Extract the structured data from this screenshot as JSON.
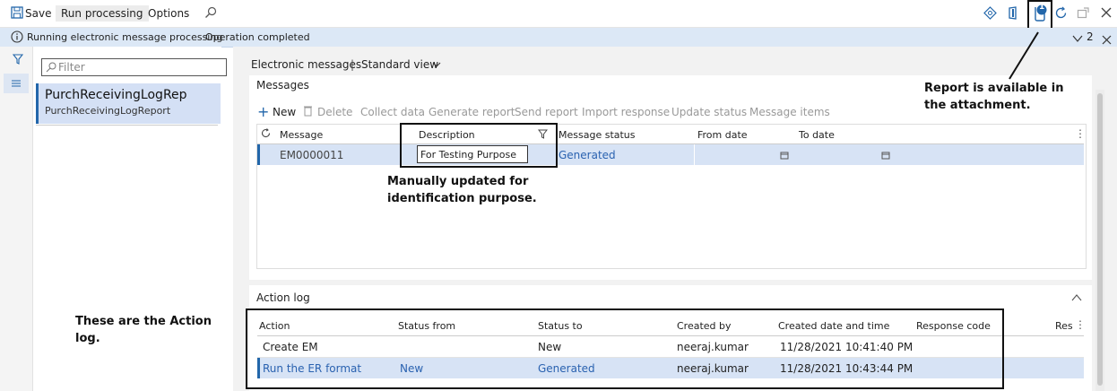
{
  "toolbar": {
    "save_label": "Save",
    "run_label": "Run processing",
    "options_label": "Options",
    "badge_count": "1"
  },
  "message_bar": {
    "title": "Running electronic message processing",
    "text": "Operation completed",
    "count": "2"
  },
  "filter": {
    "placeholder": "Filter"
  },
  "list": {
    "item_title": "PurchReceivingLogRep",
    "item_subtitle": "PurchReceivingLogReport"
  },
  "breadcrumb": {
    "page": "Electronic messages",
    "separator": "|",
    "view": "Standard view"
  },
  "messages": {
    "section_title": "Messages",
    "actions": [
      "New",
      "Delete",
      "Collect data",
      "Generate report",
      "Send report",
      "Import response",
      "Update status",
      "Message items"
    ],
    "columns": [
      "Message",
      "Description",
      "Message status",
      "From date",
      "To date"
    ],
    "rows": [
      {
        "message": "EM0000011",
        "description": "For Testing Purpose",
        "status": "Generated"
      }
    ]
  },
  "action_log": {
    "section_title": "Action log",
    "columns": [
      "Action",
      "Status from",
      "Status to",
      "Created by",
      "Created date and time",
      "Response code",
      "Res"
    ],
    "rows": [
      {
        "action": "Create EM",
        "from": "",
        "to": "New",
        "by": "neeraj.kumar",
        "date": "11/28/2021 10:41:40 PM"
      },
      {
        "action": "Run the ER format",
        "from": "New",
        "to": "Generated",
        "by": "neeraj.kumar",
        "date": "11/28/2021 10:43:44 PM"
      }
    ]
  },
  "annotations": {
    "attachment": "Report is available in the attachment.",
    "description": "Manually updated for identification purpose.",
    "action_log": "These are the Action log."
  },
  "colors": {
    "accent": "#2266aa",
    "selection": "#d7e3f5",
    "message_bar": "#dce8f6"
  }
}
